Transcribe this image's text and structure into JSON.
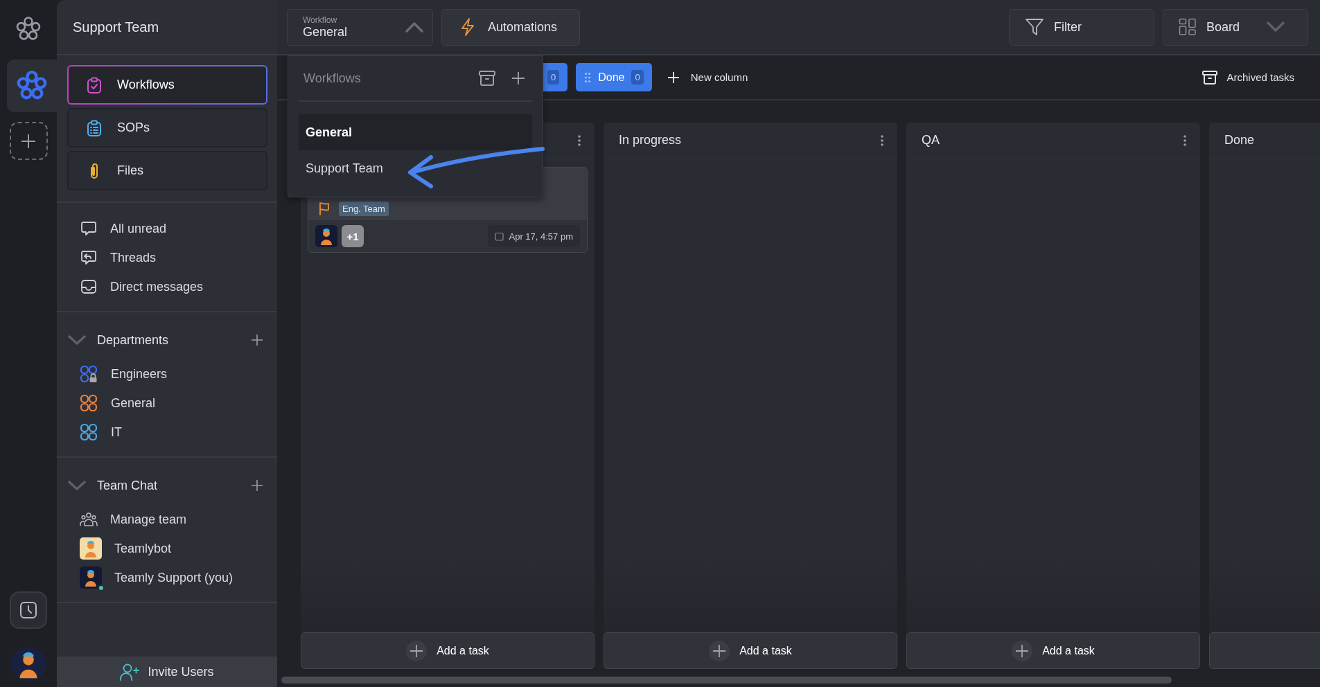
{
  "rail": {
    "workspaces": [
      {
        "selected": true
      }
    ]
  },
  "sidebar": {
    "title": "Support Team",
    "nav": [
      {
        "label": "Workflows",
        "kind": "workflows",
        "selected": true
      },
      {
        "label": "SOPs",
        "kind": "sops",
        "selected": false
      },
      {
        "label": "Files",
        "kind": "files",
        "selected": false
      }
    ],
    "quick_links": [
      {
        "label": "All unread",
        "kind": "unread"
      },
      {
        "label": "Threads",
        "kind": "threads"
      },
      {
        "label": "Direct messages",
        "kind": "direct"
      }
    ],
    "sections": [
      {
        "title": "Departments",
        "expanded": true,
        "items": [
          {
            "label": "Engineers",
            "kind": "channel",
            "color": "#3b6ef0",
            "locked": true
          },
          {
            "label": "General",
            "kind": "channel",
            "color": "#e8803a",
            "locked": false
          },
          {
            "label": "IT",
            "kind": "channel",
            "color": "#4aa8e8",
            "locked": false
          }
        ]
      },
      {
        "title": "Team Chat",
        "expanded": true,
        "items": [
          {
            "label": "Manage team",
            "kind": "team"
          },
          {
            "label": "Teamlybot",
            "kind": "bot"
          },
          {
            "label": "Teamly Support (you)",
            "kind": "user",
            "online": true
          }
        ]
      }
    ],
    "invite_button": "Invite Users"
  },
  "topbar": {
    "workflow_select": {
      "label": "Workflow",
      "value": "General",
      "expanded": true
    },
    "automations": "Automations",
    "filter": "Filter",
    "view_select": {
      "value": "Board"
    }
  },
  "toolbar": {
    "column_chips": [
      {
        "count": "0"
      },
      {
        "label": "Done",
        "count": "0"
      }
    ],
    "new_column": "New column",
    "archived": "Archived tasks"
  },
  "dropdown": {
    "title": "Workflows",
    "items": [
      {
        "label": "General",
        "selected": true
      },
      {
        "label": "Support Team",
        "selected": false
      }
    ]
  },
  "columns": [
    {
      "has_menu": true,
      "cards": [
        {
          "tag": "Eng. Team",
          "extra_assignees": "+1",
          "due": "Apr 17, 4:57 pm"
        }
      ],
      "add_label": "Add a task"
    },
    {
      "title": "In progress",
      "has_menu": true,
      "add_label": "Add a task"
    },
    {
      "title": "QA",
      "has_menu": true,
      "add_label": "Add a task"
    },
    {
      "title": "Done"
    }
  ]
}
